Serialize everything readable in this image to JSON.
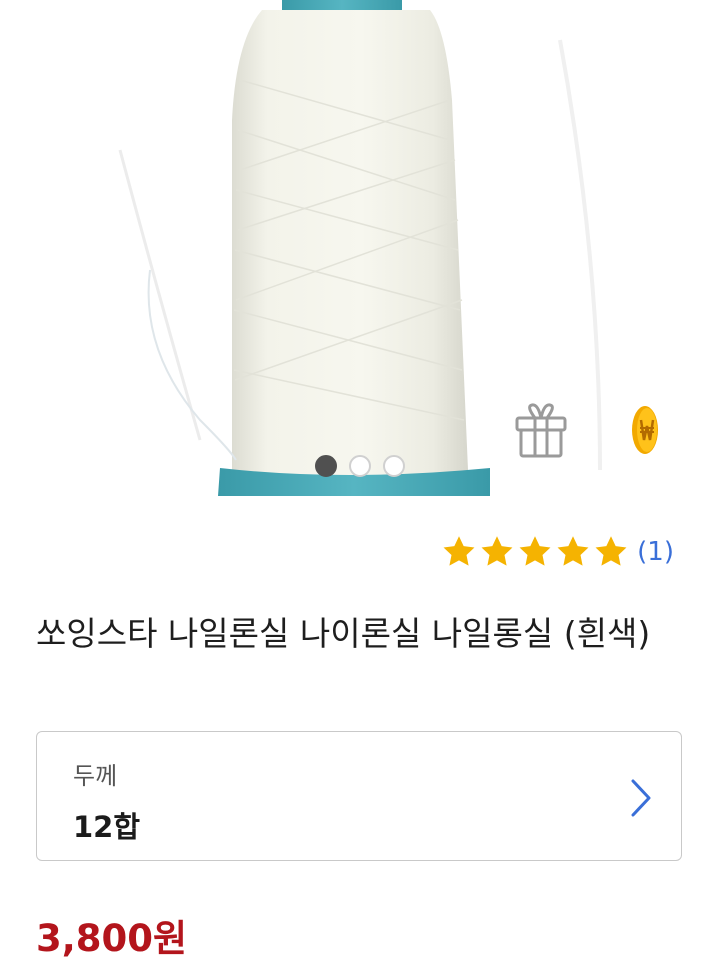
{
  "product_image": {
    "alt_icon": "thread-spool-photo",
    "carousel": {
      "total": 3,
      "active_index": 0
    },
    "gift_icon": "gift-icon",
    "point_icon": "coin-icon"
  },
  "rating": {
    "stars": 5,
    "max_stars": 5,
    "review_count": "(1)",
    "star_color": "#f5b301"
  },
  "product": {
    "title": "쏘잉스타 나일론실 나이론실 나일롱실 (흰색)"
  },
  "option": {
    "label": "두께",
    "value": "12합",
    "chevron_icon": "chevron-right-icon"
  },
  "price": {
    "text": "3,800원",
    "color": "#b3151c"
  }
}
